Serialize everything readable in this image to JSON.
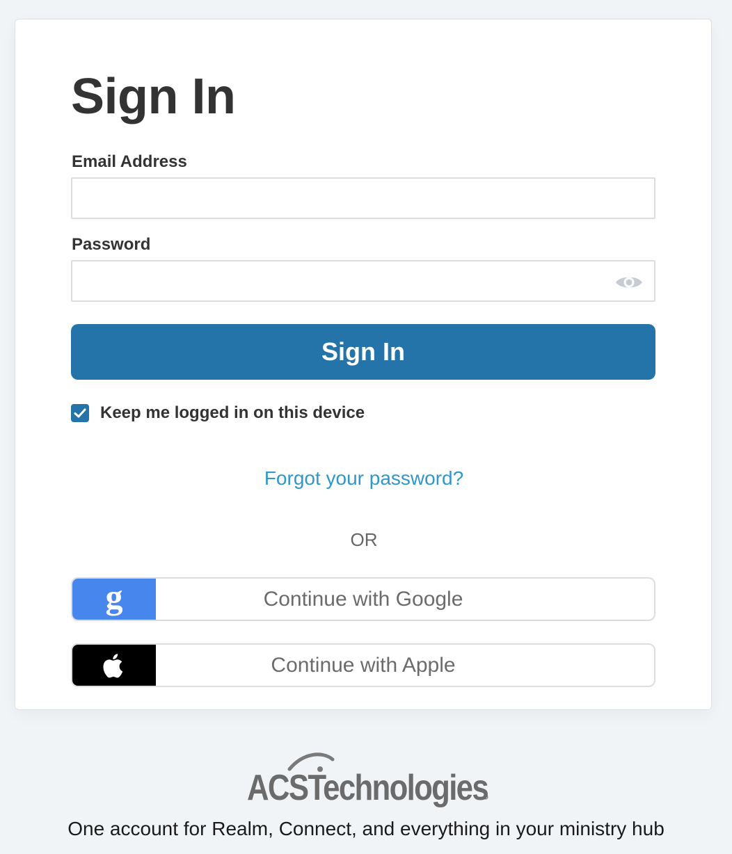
{
  "colors": {
    "background": "#f1f4f7",
    "card": "#ffffff",
    "primary": "#2574a9",
    "link": "#3096cc",
    "google": "#4787ed",
    "apple": "#000000"
  },
  "form": {
    "title": "Sign In",
    "email": {
      "label": "Email Address",
      "value": "",
      "placeholder": ""
    },
    "password": {
      "label": "Password",
      "value": "",
      "placeholder": "",
      "toggle_icon": "eye-icon"
    },
    "submit_label": "Sign In",
    "keep_logged_in": {
      "label": "Keep me logged in on this device",
      "checked": true
    },
    "forgot_link": "Forgot your password?",
    "divider": "OR",
    "social": [
      {
        "provider": "google",
        "label": "Continue with Google",
        "icon": "google-g-icon"
      },
      {
        "provider": "apple",
        "label": "Continue with Apple",
        "icon": "apple-icon"
      }
    ]
  },
  "footer": {
    "logo_text": "ACSTechnologies",
    "tagline": "One account for Realm, Connect, and everything in your ministry hub"
  }
}
